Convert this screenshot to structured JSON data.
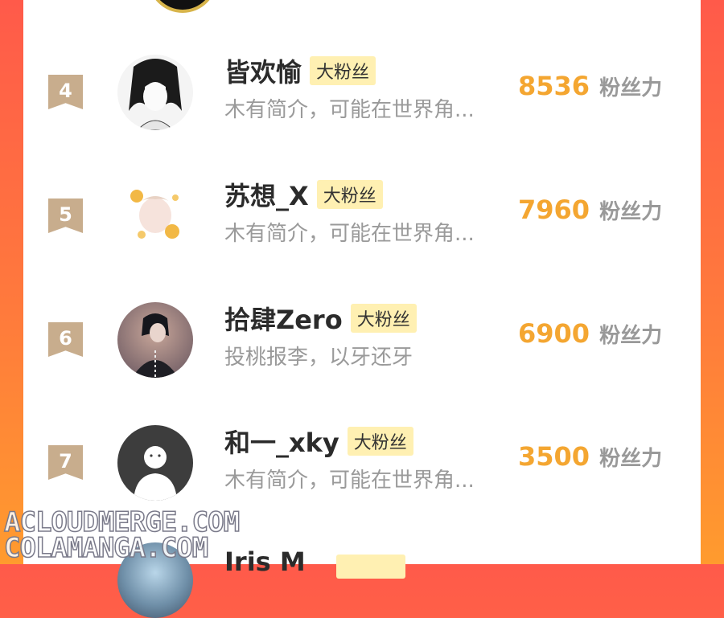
{
  "leaderboard": {
    "rows": [
      {
        "rank": "4",
        "name": "皆欢愉",
        "badge": "大粉丝",
        "desc": "木有简介，可能在世界角...",
        "score": "8536",
        "unit": "粉丝力"
      },
      {
        "rank": "5",
        "name": "苏想_X",
        "badge": "大粉丝",
        "desc": "木有简介，可能在世界角...",
        "score": "7960",
        "unit": "粉丝力"
      },
      {
        "rank": "6",
        "name": "拾肆Zero",
        "badge": "大粉丝",
        "desc": "投桃报李，以牙还牙",
        "score": "6900",
        "unit": "粉丝力"
      },
      {
        "rank": "7",
        "name": "和一_xky",
        "badge": "大粉丝",
        "desc": "木有简介，可能在世界角...",
        "score": "3500",
        "unit": "粉丝力"
      }
    ],
    "partial_next": {
      "name": "Iris M"
    }
  },
  "watermarks": {
    "line1": "ACLOUDMERGE.COM",
    "line2": "COLAMANGA.COM"
  },
  "colors": {
    "accent": "#f4a631",
    "badge_bg": "#fff0b2",
    "rank_ribbon": "#c8ad8d",
    "gradient_left": "#ff5a4a",
    "gradient_right": "#ff9b2e"
  }
}
